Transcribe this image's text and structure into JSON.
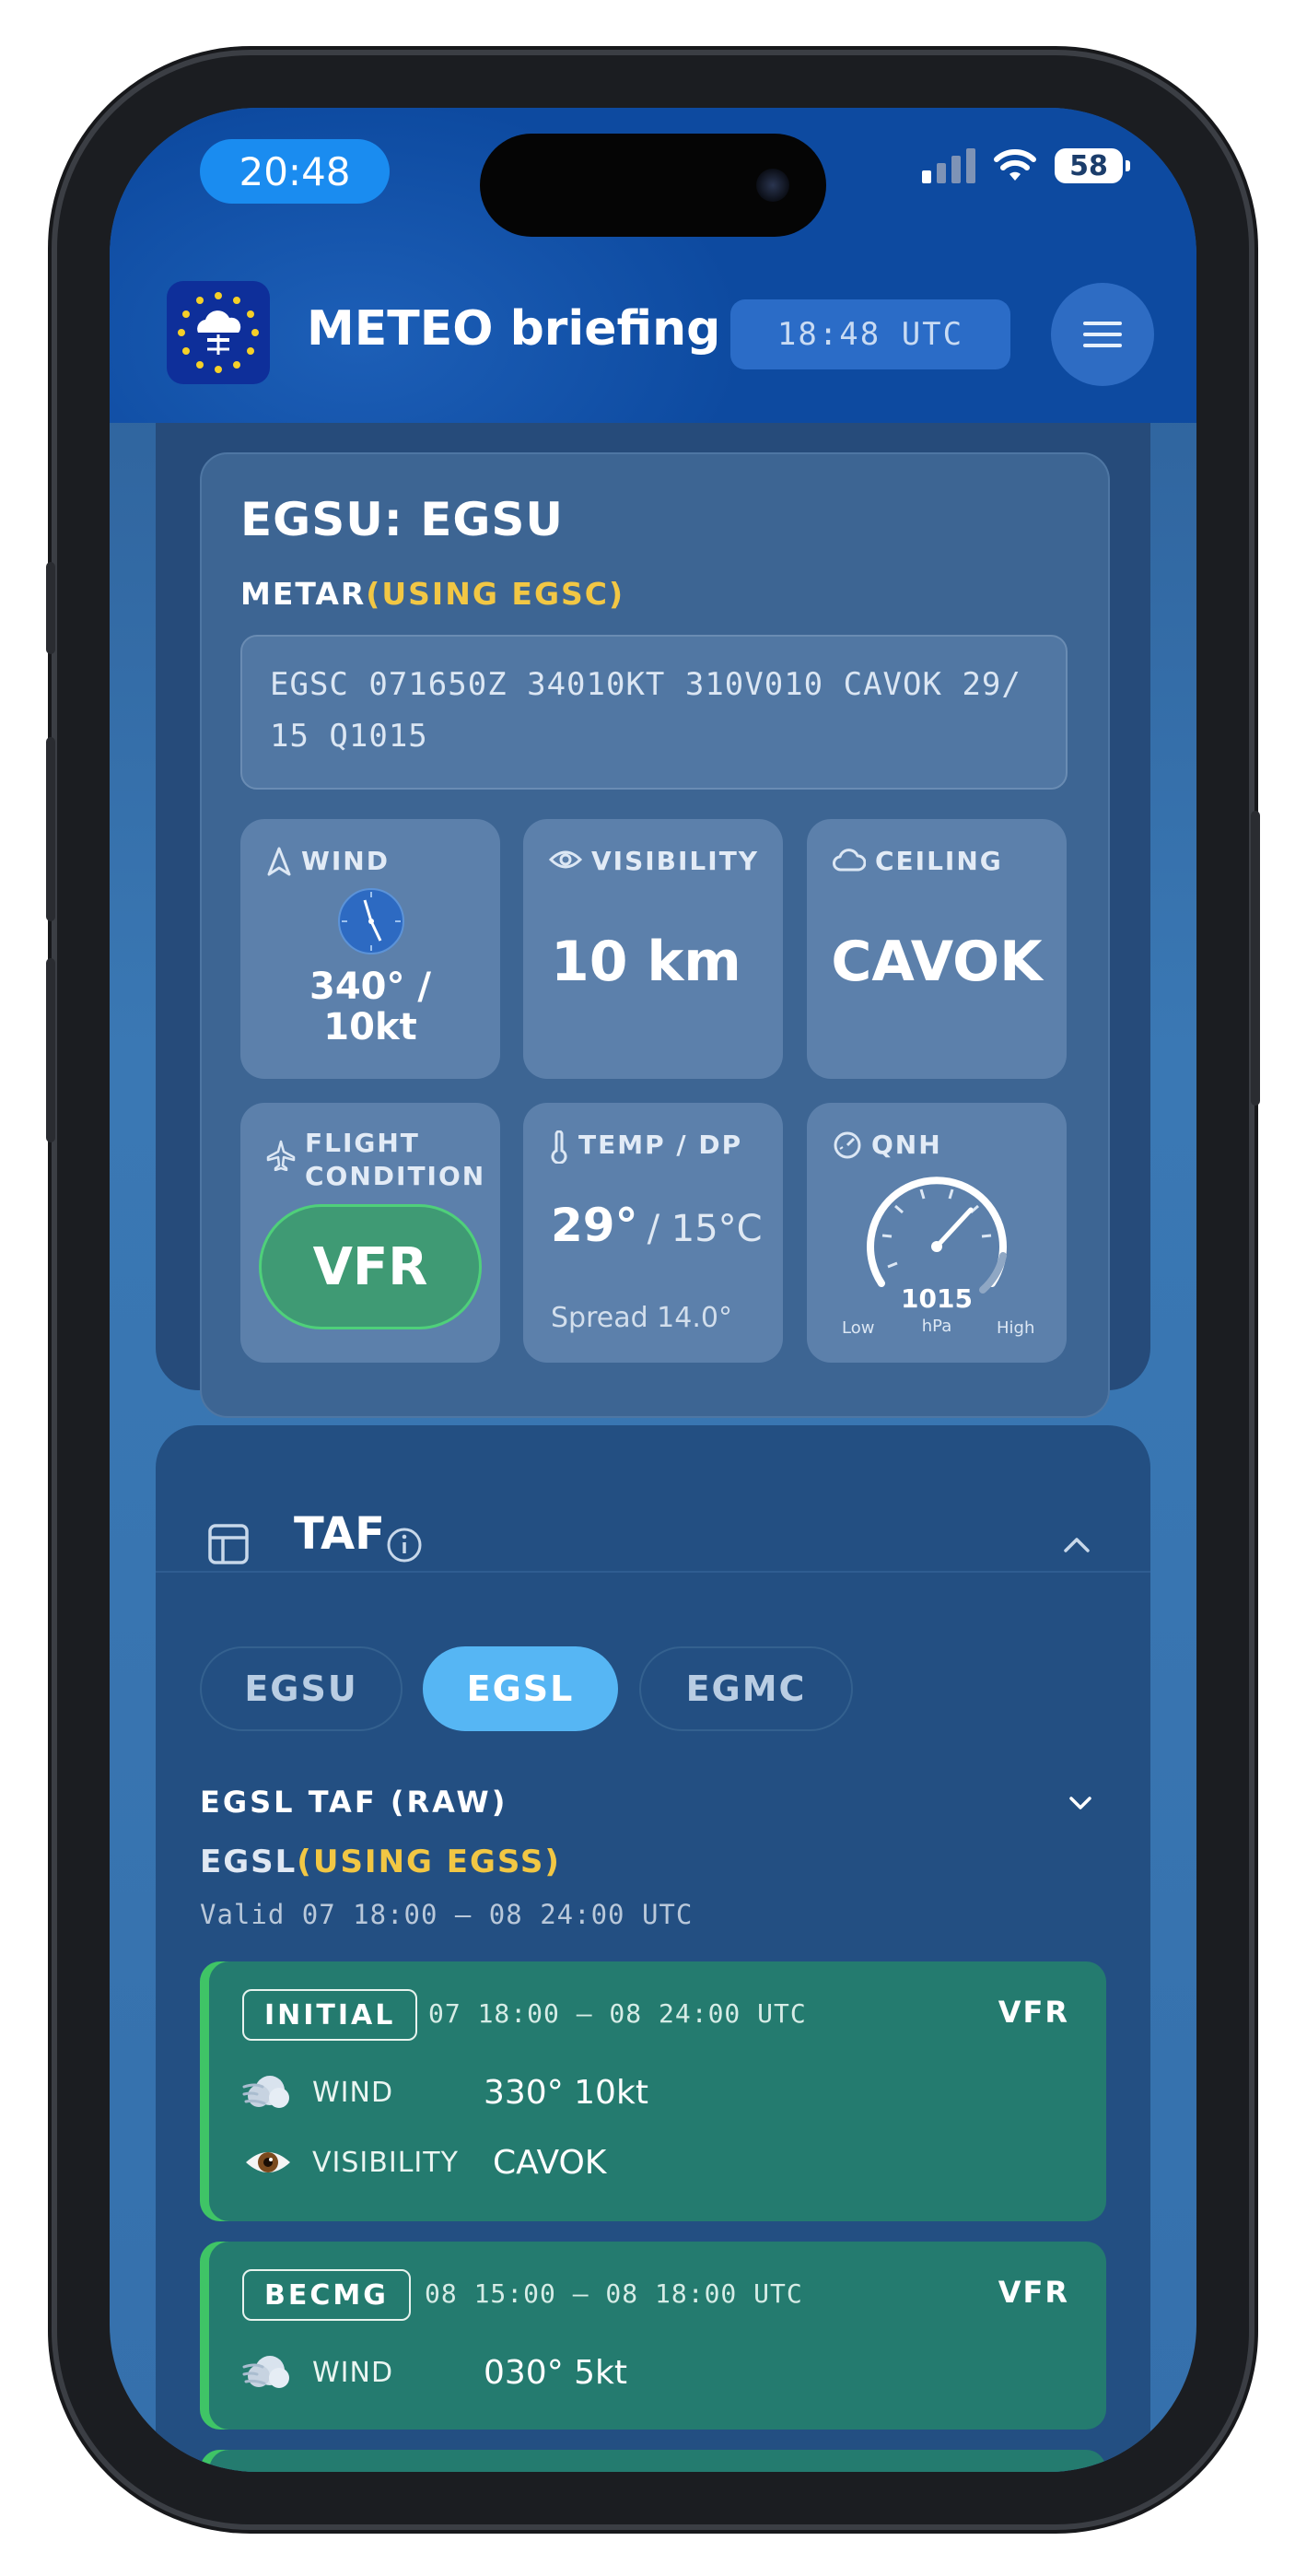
{
  "status_bar": {
    "time": "20:48",
    "battery": "58"
  },
  "header": {
    "title": "METEO briefing",
    "utc_time": "18:48 UTC"
  },
  "metar": {
    "station_title": "EGSU: EGSU",
    "label": "METAR",
    "using": "(USING EGSC)",
    "raw_line1": "EGSC 071650Z 34010KT 310V010 CAVOK 29/",
    "raw_line2": "15 Q1015",
    "wind": {
      "label": "WIND",
      "value_line1": "340° /",
      "value_line2": "10kt",
      "direction_deg": 340
    },
    "visibility": {
      "label": "VISIBILITY",
      "value": "10 km"
    },
    "ceiling": {
      "label": "CEILING",
      "value": "CAVOK"
    },
    "flight_condition": {
      "label_line1": "FLIGHT",
      "label_line2": "CONDITION",
      "value": "VFR"
    },
    "temp_dp": {
      "label": "TEMP / DP",
      "temp": "29°",
      "dew": "/ 15°C",
      "spread": "Spread 14.0°"
    },
    "qnh": {
      "label": "QNH",
      "value": "1015",
      "unit": "hPa",
      "low": "Low",
      "high": "High"
    }
  },
  "taf": {
    "title": "TAF",
    "tabs": [
      "EGSU",
      "EGSL",
      "EGMC"
    ],
    "active_tab": "EGSL",
    "raw_label": "EGSL TAF (RAW)",
    "station": "EGSL",
    "using": "(USING EGSS)",
    "valid": "Valid 07 18:00 – 08 24:00 UTC",
    "periods": [
      {
        "type": "INITIAL",
        "time": "07 18:00 – 08 24:00 UTC",
        "category": "VFR",
        "rows": [
          {
            "label": "WIND",
            "value": "330° 10kt"
          },
          {
            "label": "VISIBILITY",
            "value": "CAVOK"
          }
        ]
      },
      {
        "type": "BECMG",
        "time": "08 15:00 – 08 18:00 UTC",
        "category": "VFR",
        "rows": [
          {
            "label": "WIND",
            "value": "030° 5kt"
          }
        ]
      }
    ]
  },
  "icons": [
    "wind-arrow-icon",
    "eye-icon",
    "cloud-icon",
    "plane-icon",
    "thermometer-icon",
    "gauge-icon",
    "layout-icon",
    "info-icon",
    "chevron-up-icon",
    "chevron-down-icon",
    "wind-emoji-icon",
    "eye-emoji-icon",
    "menu-icon"
  ],
  "colors": {
    "accent": "#56b6f4",
    "vfr_green": "#3fc466",
    "period_bg": "#247b6f",
    "using_yellow": "#f2c744"
  }
}
